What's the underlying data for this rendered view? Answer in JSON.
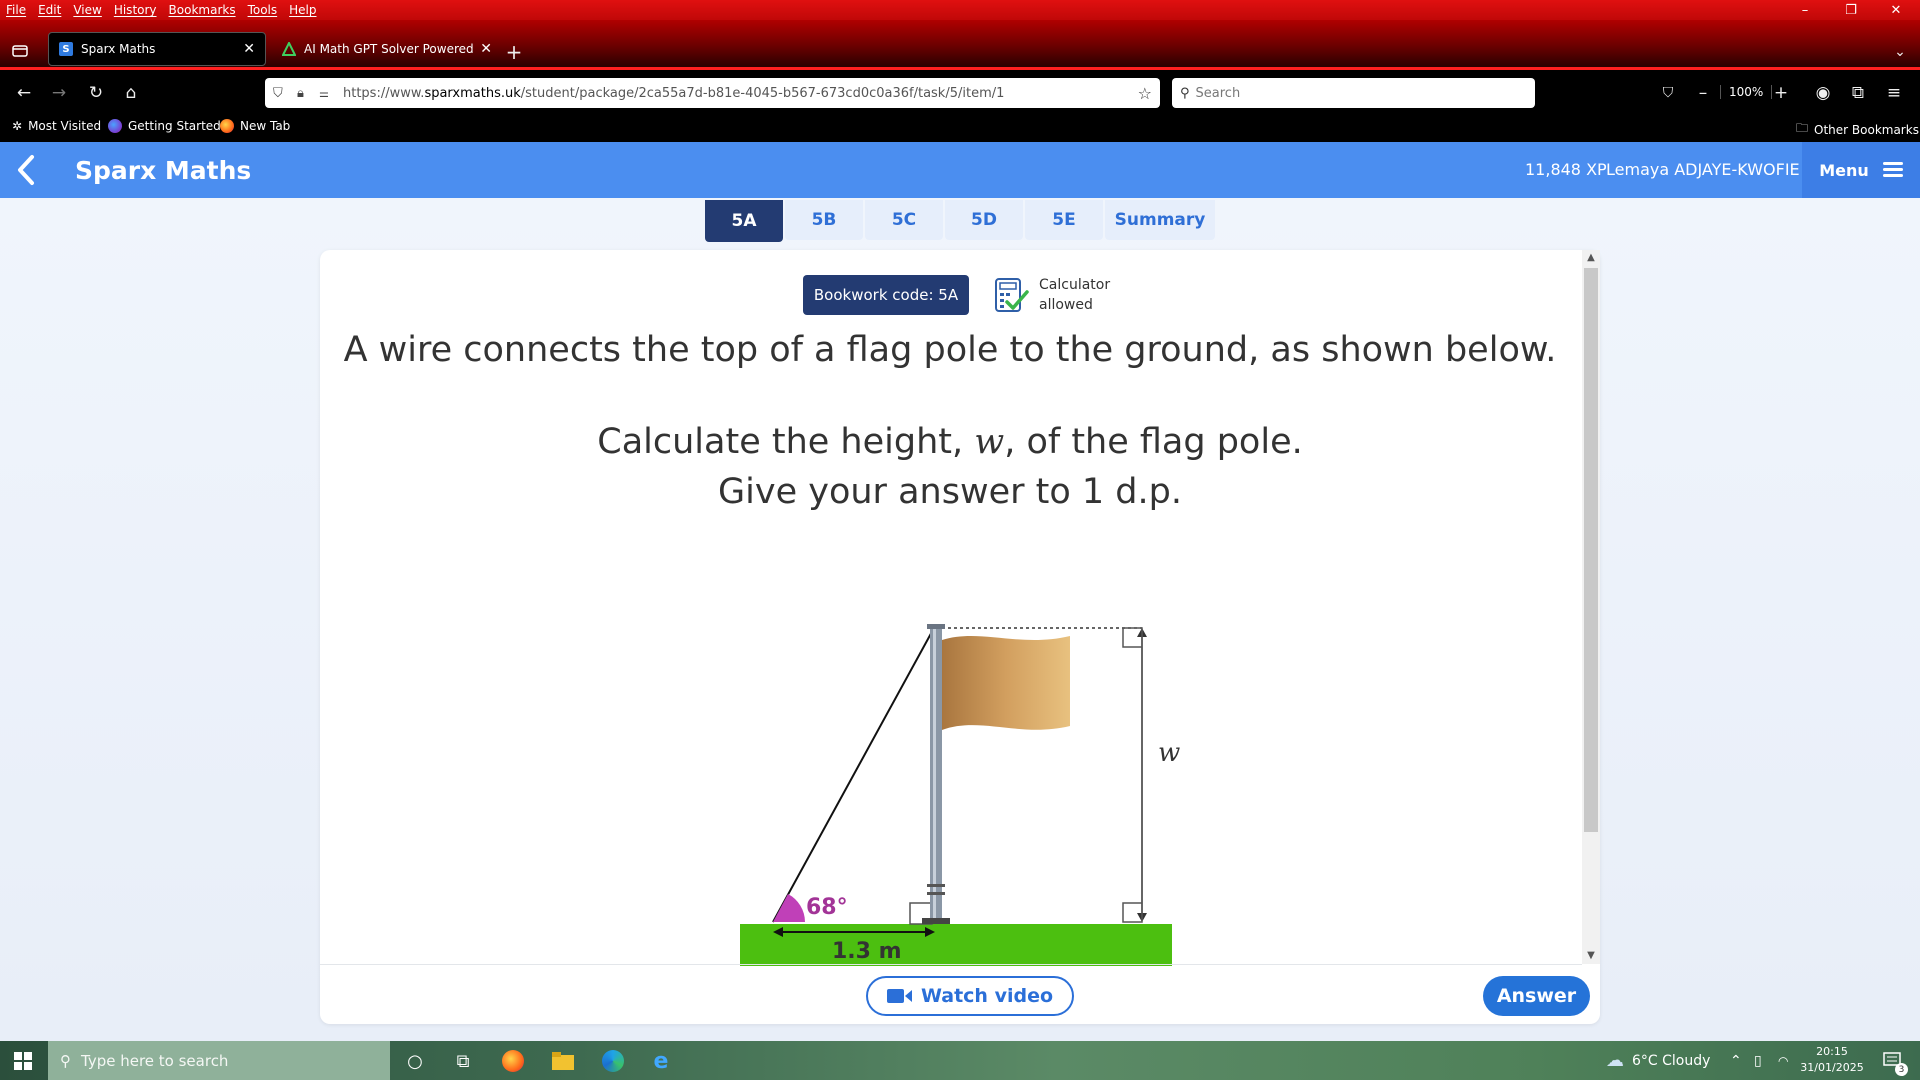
{
  "menubar": {
    "items": [
      "File",
      "Edit",
      "View",
      "History",
      "Bookmarks",
      "Tools",
      "Help"
    ]
  },
  "tabs": [
    {
      "title": "Sparx Maths",
      "active": true
    },
    {
      "title": "AI Math GPT Solver Powered by",
      "active": false
    }
  ],
  "nav": {
    "url_prefix": "https://www.",
    "url_host": "sparxmaths.uk",
    "url_path": "/student/package/2ca55a7d-b81e-4045-b567-673cd0c0a36f/task/5/item/1",
    "search_placeholder": "Search",
    "zoom": "100%"
  },
  "bookmarks": {
    "items": [
      "Most Visited",
      "Getting Started",
      "New Tab"
    ],
    "other": "Other Bookmarks"
  },
  "header": {
    "brand": "Sparx Maths",
    "xp": "11,848 XP",
    "user": "Lemaya ADJAYE-KWOFIE",
    "menu": "Menu"
  },
  "question_tabs": [
    "5A",
    "5B",
    "5C",
    "5D",
    "5E",
    "Summary"
  ],
  "card": {
    "bookwork": "Bookwork code: 5A",
    "calc_line1": "Calculator",
    "calc_line2": "allowed",
    "q_line1": "A wire connects the top of a flag pole to the ground, as shown below.",
    "q_line2_a": "Calculate the height, ",
    "q_line2_var": "w",
    "q_line2_b": ", of the flag pole.",
    "q_line3": "Give your answer to 1 d.p.",
    "watch": "Watch video",
    "answer": "Answer"
  },
  "diagram": {
    "angle_label": "68°",
    "base_label": "1.3 m",
    "height_label": "w",
    "colors": {
      "ground": "#4cbf10",
      "angle": "#c040b8",
      "flag": "#d8ad6b"
    }
  },
  "taskbar": {
    "search_placeholder": "Type here to search",
    "weather": "6°C  Cloudy",
    "time": "20:15",
    "date": "31/01/2025",
    "notifications": "3"
  }
}
